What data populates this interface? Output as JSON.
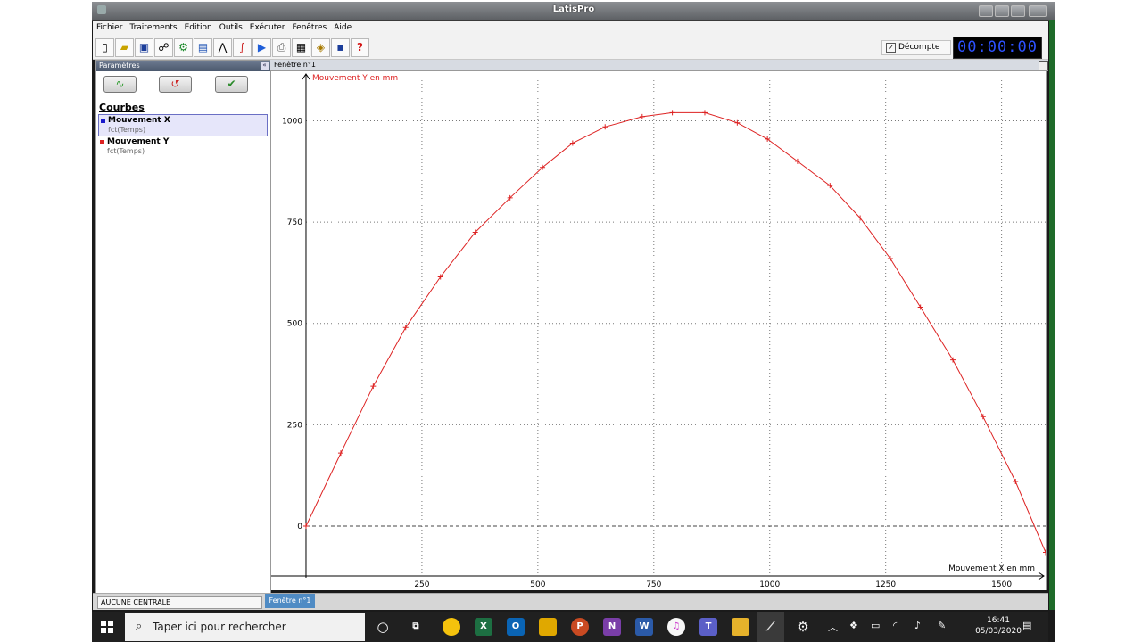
{
  "window": {
    "title": "LatisPro"
  },
  "menu": [
    "Fichier",
    "Traitements",
    "Edition",
    "Outils",
    "Exécuter",
    "Fenêtres",
    "Aide"
  ],
  "toolbar": {
    "icons": [
      "new-file-icon",
      "open-folder-icon",
      "save-icon",
      "acquisition-icon",
      "settings-icon",
      "table-icon",
      "peak-icon",
      "modelling-icon",
      "play-icon",
      "print-icon",
      "calculator-icon",
      "measure-icon",
      "info-icon",
      "help-icon"
    ],
    "decompte_label": "Décompte",
    "decompte_checked": true,
    "clock": "00:00:00"
  },
  "left_panel": {
    "header": "Paramètres",
    "section_title": "Courbes",
    "curves": [
      {
        "name": "Mouvement X",
        "func": "fct(Temps)",
        "color": "#1a1acc",
        "selected": true
      },
      {
        "name": "Mouvement Y",
        "func": "fct(Temps)",
        "color": "#dd2222",
        "selected": false
      }
    ]
  },
  "window_panel": {
    "title": "Fenêtre n°1"
  },
  "chart_data": {
    "type": "line",
    "ylabel": "Mouvement Y en mm",
    "xlabel": "Mouvement X en mm",
    "x_ticks": [
      250,
      500,
      750,
      1000,
      1250,
      1500
    ],
    "y_ticks": [
      0,
      250,
      500,
      750,
      1000
    ],
    "xlim": [
      -75,
      1595
    ],
    "ylim": [
      -110,
      1100
    ],
    "grid": true,
    "color": "#dd2222",
    "series": [
      {
        "x": [
          0,
          75,
          145,
          215,
          290,
          365,
          440,
          510,
          575,
          645,
          725,
          790,
          860,
          930,
          995,
          1060,
          1130,
          1195,
          1260,
          1325,
          1395,
          1460,
          1530,
          1595
        ],
        "y": [
          0,
          180,
          345,
          490,
          615,
          725,
          810,
          885,
          945,
          985,
          1010,
          1020,
          1020,
          995,
          955,
          900,
          840,
          760,
          660,
          540,
          410,
          270,
          110,
          -65
        ]
      }
    ]
  },
  "status": {
    "left": "AUCUNE CENTRALE",
    "tab": "Fenêtre n°1"
  },
  "taskbar": {
    "search_placeholder": "Taper ici pour rechercher",
    "apps": [
      "cortana-icon",
      "task-view-icon",
      "chrome-icon",
      "excel-icon",
      "outlook-icon",
      "file-app-icon",
      "powerpoint-icon",
      "onenote-icon",
      "word-icon",
      "itunes-icon",
      "teams-icon",
      "explorer-icon",
      "latispro-icon",
      "gear-icon"
    ],
    "time": "16:41",
    "date": "05/03/2020"
  }
}
